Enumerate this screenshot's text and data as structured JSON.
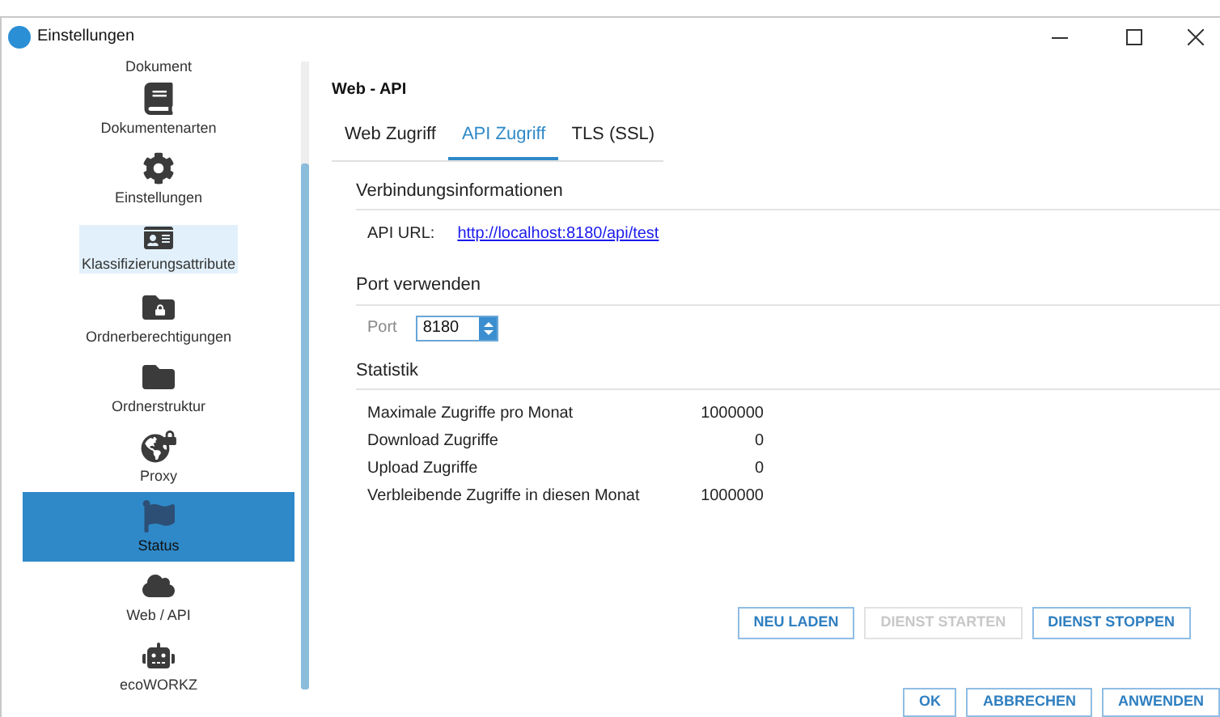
{
  "window": {
    "title": "Einstellungen"
  },
  "sidebar": {
    "items": [
      {
        "label": "Dokument",
        "selected": false,
        "hovered": false
      },
      {
        "label": "Dokumentenarten",
        "selected": false,
        "hovered": false
      },
      {
        "label": "Einstellungen",
        "selected": false,
        "hovered": false
      },
      {
        "label": "Klassifizierungsattribute",
        "selected": false,
        "hovered": true
      },
      {
        "label": "Ordnerberechtigungen",
        "selected": false,
        "hovered": false
      },
      {
        "label": "Ordnerstruktur",
        "selected": false,
        "hovered": false
      },
      {
        "label": "Proxy",
        "selected": false,
        "hovered": false
      },
      {
        "label": "Status",
        "selected": true,
        "hovered": false
      },
      {
        "label": "Web / API",
        "selected": false,
        "hovered": false
      },
      {
        "label": "ecoWORKZ",
        "selected": false,
        "hovered": false
      }
    ]
  },
  "page": {
    "title": "Web - API",
    "tabs": [
      {
        "label": "Web Zugriff",
        "selected": false
      },
      {
        "label": "API Zugriff",
        "selected": true
      },
      {
        "label": "TLS (SSL)",
        "selected": false
      }
    ],
    "connection": {
      "heading": "Verbindungsinformationen",
      "label": "API URL:",
      "link": "http://localhost:8180/api/test"
    },
    "port": {
      "heading": "Port verwenden",
      "label": "Port",
      "value": "8180"
    },
    "statistics": {
      "heading": "Statistik",
      "rows": [
        {
          "label": "Maximale Zugriffe pro Monat",
          "value": "1000000"
        },
        {
          "label": "Download Zugriffe",
          "value": "0"
        },
        {
          "label": "Upload Zugriffe",
          "value": "0"
        },
        {
          "label": "Verbleibende Zugriffe in diesen Monat",
          "value": "1000000"
        }
      ]
    },
    "service_buttons": [
      {
        "label": "NEU LADEN",
        "disabled": false
      },
      {
        "label": "DIENST STARTEN",
        "disabled": true
      },
      {
        "label": "DIENST STOPPEN",
        "disabled": false
      }
    ]
  },
  "dialog_buttons": [
    {
      "label": "OK"
    },
    {
      "label": "ABBRECHEN"
    },
    {
      "label": "ANWENDEN"
    }
  ]
}
